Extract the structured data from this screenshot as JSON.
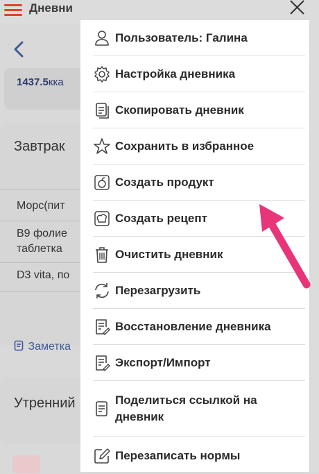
{
  "background": {
    "header_title": "Дневни",
    "calories_value": "1437.5",
    "calories_unit": "кка",
    "meal_breakfast": "Завтрак",
    "rows": [
      "Морс(пит",
      "B9 фолие",
      "таблетка",
      "D3 vita, по"
    ],
    "notes_label": "Заметка",
    "meal_morning": "Утренний"
  },
  "menu": {
    "items": [
      {
        "label": "Пользователь: Галина",
        "icon": "user-icon"
      },
      {
        "label": "Настройка дневника",
        "icon": "gear-icon"
      },
      {
        "label": "Скопировать дневник",
        "icon": "copy-document-icon"
      },
      {
        "label": "Сохранить в избранное",
        "icon": "star-icon"
      },
      {
        "label": "Создать продукт",
        "icon": "apple-icon"
      },
      {
        "label": "Создать рецепт",
        "icon": "chef-hat-icon"
      },
      {
        "label": "Очистить дневник",
        "icon": "trash-icon"
      },
      {
        "label": "Перезагрузить",
        "icon": "reload-icon"
      },
      {
        "label": "Восстановление дневника",
        "icon": "document-edit-icon"
      },
      {
        "label": "Экспорт/Импорт",
        "icon": "document-edit-icon"
      },
      {
        "label": "Поделиться ссылкой на дневник",
        "icon": "document-icon"
      },
      {
        "label": "Перезаписать нормы",
        "icon": "pencil-square-icon"
      }
    ]
  },
  "colors": {
    "accent_red": "#d9472b",
    "arrow_pink": "#e8357a",
    "link_blue": "#3f5a96"
  }
}
